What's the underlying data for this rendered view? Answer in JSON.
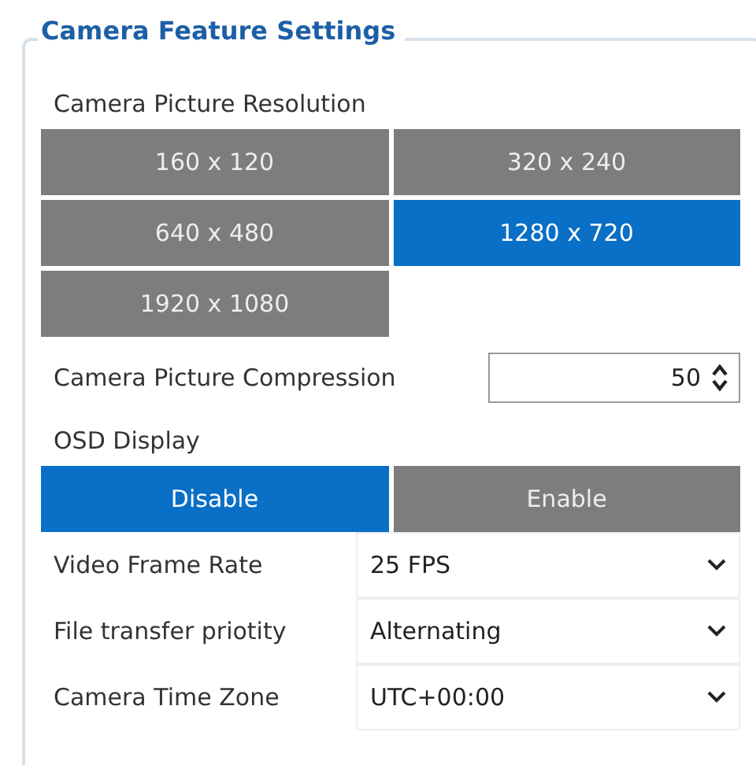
{
  "group": {
    "title": "Camera Feature Settings"
  },
  "resolution": {
    "label": "Camera Picture Resolution",
    "options": [
      {
        "label": "160 x 120",
        "selected": false
      },
      {
        "label": "320 x 240",
        "selected": false
      },
      {
        "label": "640 x 480",
        "selected": false
      },
      {
        "label": "1280 x 720",
        "selected": true
      },
      {
        "label": "1920 x 1080",
        "selected": false
      }
    ]
  },
  "compression": {
    "label": "Camera Picture Compression",
    "value": "50"
  },
  "osd": {
    "label": "OSD Display",
    "options": [
      {
        "label": "Disable",
        "selected": true
      },
      {
        "label": "Enable",
        "selected": false
      }
    ]
  },
  "dropdowns": [
    {
      "label": "Video Frame Rate",
      "value": "25 FPS"
    },
    {
      "label": "File transfer priotity",
      "value": "Alternating"
    },
    {
      "label": "Camera Time Zone",
      "value": "UTC+00:00"
    }
  ]
}
